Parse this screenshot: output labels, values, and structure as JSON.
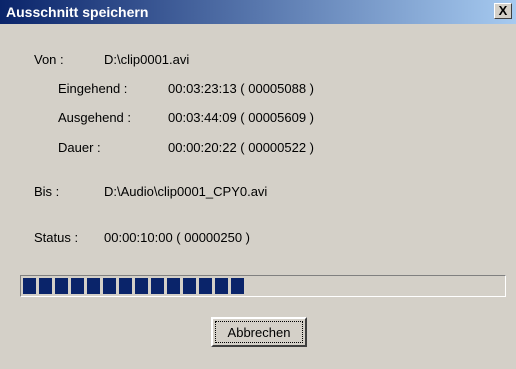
{
  "window": {
    "title": "Ausschnitt speichern",
    "close_label": "X"
  },
  "source": {
    "von_label": "Von :",
    "von_value": "D:\\clip0001.avi"
  },
  "eingehend": {
    "label": "Eingehend :",
    "value": "00:03:23:13 ( 00005088 )"
  },
  "ausgehend": {
    "label": "Ausgehend :",
    "value": "00:03:44:09 ( 00005609 )"
  },
  "dauer": {
    "label": "Dauer :",
    "value": "00:00:20:22 ( 00000522 )"
  },
  "target": {
    "bis_label": "Bis :",
    "bis_value": "D:\\Audio\\clip0001_CPY0.avi"
  },
  "status": {
    "label": "Status :",
    "value": "00:00:10:00 ( 00000250 )"
  },
  "progress": {
    "fraction": 0.48,
    "color": "#0a246a"
  },
  "buttons": {
    "cancel_label": "Abbrechen"
  }
}
